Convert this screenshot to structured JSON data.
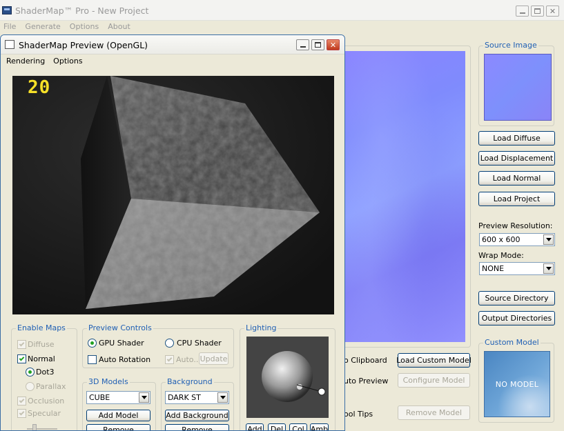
{
  "app": {
    "title": "ShaderMap™ Pro - New Project",
    "menu": [
      "File",
      "Generate",
      "Options",
      "About"
    ]
  },
  "right_panel": {
    "source_image_label": "Source Image",
    "buttons": [
      "Load Diffuse",
      "Load Displacement",
      "Load Normal",
      "Load Project"
    ],
    "preview_resolution_label": "Preview Resolution:",
    "preview_resolution_value": "600 x 600",
    "wrap_mode_label": "Wrap Mode:",
    "wrap_mode_value": "NONE",
    "source_directory": "Source Directory",
    "output_directories": "Output Directories",
    "custom_model_label": "Custom Model",
    "no_model": "NO MODEL"
  },
  "middle": {
    "clipboard_label": "o Clipboard",
    "auto_preview_label": "uto Preview",
    "tool_tips_label": "ool Tips",
    "load_custom_model": "Load Custom Model",
    "configure_model": "Configure Model",
    "remove_model": "Remove Model"
  },
  "preview": {
    "title": "ShaderMap Preview (OpenGL)",
    "menu": [
      "Rendering",
      "Options"
    ],
    "fps": "20",
    "enable_maps": {
      "label": "Enable Maps",
      "diffuse": "Diffuse",
      "normal": "Normal",
      "dot3": "Dot3",
      "parallax": "Parallax",
      "occlusion": "Occlusion",
      "specular": "Specular"
    },
    "preview_controls": {
      "label": "Preview Controls",
      "gpu_shader": "GPU Shader",
      "cpu_shader": "CPU Shader",
      "auto_rotation": "Auto Rotation",
      "auto": "Auto...",
      "update": "Update"
    },
    "models": {
      "label": "3D Models",
      "value": "CUBE",
      "add": "Add Model",
      "remove": "Remove"
    },
    "background": {
      "label": "Background",
      "value": "DARK ST",
      "add": "Add Background",
      "remove": "Remove"
    },
    "lighting": {
      "label": "Lighting",
      "buttons": [
        "Add",
        "Del",
        "Col",
        "Amb"
      ]
    }
  }
}
